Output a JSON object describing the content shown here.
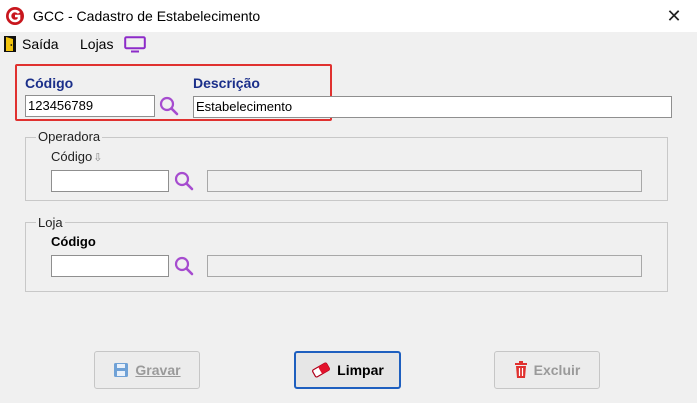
{
  "window": {
    "title": "GCC - Cadastro de Estabelecimento",
    "close_glyph": "✕"
  },
  "menu": {
    "saida": {
      "label": "Saída",
      "icon": "exit-door-icon"
    },
    "lojas": {
      "label": "Lojas",
      "icon": "monitor-icon"
    }
  },
  "estabelecimento": {
    "codigo_label": "Código",
    "codigo_value": "123456789",
    "descricao_label": "Descrição",
    "descricao_value": "Estabelecimento"
  },
  "operadora": {
    "group_label": "Operadora",
    "codigo_label": "Código",
    "sort_indicator": "⇩",
    "codigo_value": "",
    "descricao_value": ""
  },
  "loja": {
    "group_label": "Loja",
    "codigo_label": "Código",
    "codigo_value": "",
    "descricao_value": ""
  },
  "buttons": {
    "gravar": {
      "label": "Gravar",
      "enabled": false
    },
    "limpar": {
      "label": "Limpar",
      "enabled": true
    },
    "excluir": {
      "label": "Excluir",
      "enabled": false
    }
  },
  "colors": {
    "label_blue": "#1b2f8a",
    "highlight_red": "#e0312f",
    "search_purple": "#a64ccf",
    "focus_blue": "#1e5fbf"
  }
}
